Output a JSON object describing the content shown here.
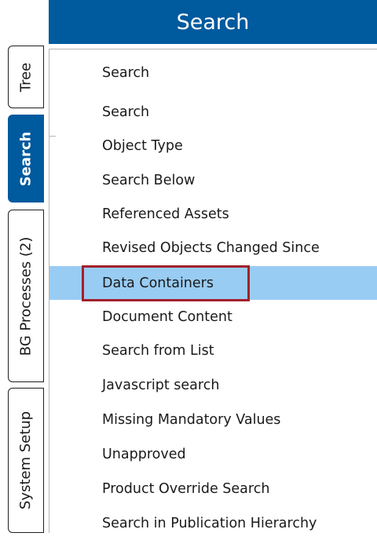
{
  "side_tabs": [
    {
      "label": "Tree",
      "active": false
    },
    {
      "label": "Search",
      "active": true
    },
    {
      "label": "BG Processes (2)",
      "active": false
    },
    {
      "label": "System Setup",
      "active": false
    }
  ],
  "header": {
    "title": "Search"
  },
  "menu": {
    "heading": "Search",
    "items": [
      "Search",
      "Object Type",
      "Search Below",
      "Referenced Assets",
      "Revised Objects Changed Since",
      "Data Containers",
      "Document Content",
      "Search from List",
      "Javascript search",
      "Missing Mandatory Values",
      "Unapproved",
      "Product Override Search",
      "Search in Publication Hierarchy"
    ],
    "selected_item": "Data Containers"
  },
  "colors": {
    "accent": "#005a9e",
    "selection": "#99ccf3",
    "annotation_box": "#a3202b"
  }
}
